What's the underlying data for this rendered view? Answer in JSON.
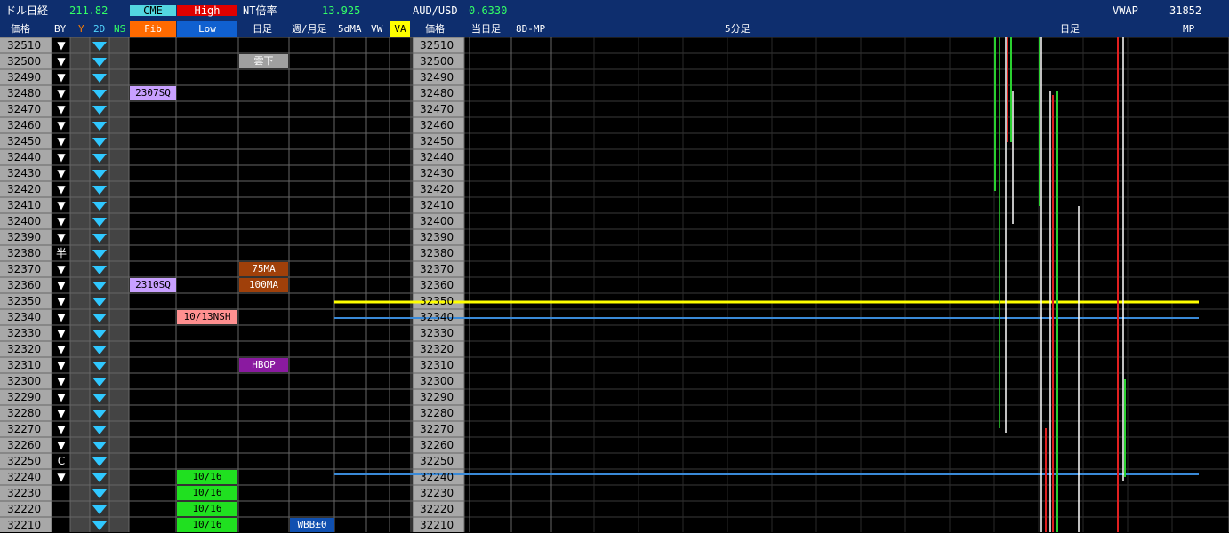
{
  "header": {
    "row1": [
      {
        "text": "ドル日経",
        "color": "#ffffff"
      },
      {
        "text": "211.82",
        "color": "#33ff66"
      },
      {
        "text": "CME",
        "color": "#000000",
        "bg": "#53d6e0"
      },
      {
        "text": "High",
        "color": "#ffffff",
        "bg": "#e00000"
      },
      {
        "text": "NT倍率",
        "color": "#ffffff"
      },
      {
        "text": "13.925",
        "color": "#33ff66"
      },
      {
        "text": "AUD/USD",
        "color": "#ffffff"
      },
      {
        "text": "0.6330",
        "color": "#33ff66"
      },
      {
        "text": "VWAP",
        "color": "#ffffff"
      },
      {
        "text": "31852",
        "color": "#ffffff"
      }
    ]
  },
  "column_headers": {
    "price": "価格",
    "by": "BY",
    "y": "Y",
    "two_d": "2D",
    "ns": "NS",
    "fib": "Fib",
    "low": "Low",
    "daily": "日足",
    "weekly": "週/月足",
    "ma5": "5dMA",
    "vw": "VW",
    "va": "VA",
    "price2": "価格",
    "today": "当日足",
    "mp8d": "8D-MP",
    "min5": "5分足",
    "daily2": "日足",
    "mp": "MP"
  },
  "prices": [
    "32510",
    "32500",
    "32490",
    "32480",
    "32470",
    "32460",
    "32450",
    "32440",
    "32430",
    "32420",
    "32410",
    "32400",
    "32390",
    "32380",
    "32370",
    "32360",
    "32350",
    "32340",
    "32330",
    "32320",
    "32310",
    "32300",
    "32290",
    "32280",
    "32270",
    "32260",
    "32250",
    "32240",
    "32230",
    "32220",
    "32210"
  ],
  "by_column": [
    "▼",
    "▼",
    "▼",
    "▼",
    "▼",
    "▼",
    "▼",
    "▼",
    "▼",
    "▼",
    "▼",
    "▼",
    "▼",
    "半",
    "▼",
    "▼",
    "▼",
    "▼",
    "▼",
    "▼",
    "▼",
    "▼",
    "▼",
    "▼",
    "▼",
    "▼",
    "C",
    "▼",
    "",
    "",
    ""
  ],
  "labels": {
    "fib_2307": "2307SQ",
    "fib_2310": "2310SQ",
    "low_nsh": "10/13NSH",
    "low_1016": "10/16",
    "daily_cloud": "雲下",
    "daily_75ma": "75MA",
    "daily_100ma": "100MA",
    "daily_hbop": "HBOP",
    "weekly_bb": "WBB±0"
  },
  "colors": {
    "header_bg": "#0e2e6e",
    "price_bg": "#a8a8a8",
    "grid": "#555555",
    "yellow_line": "#ffff00",
    "blue_line": "#3a8ad8"
  }
}
